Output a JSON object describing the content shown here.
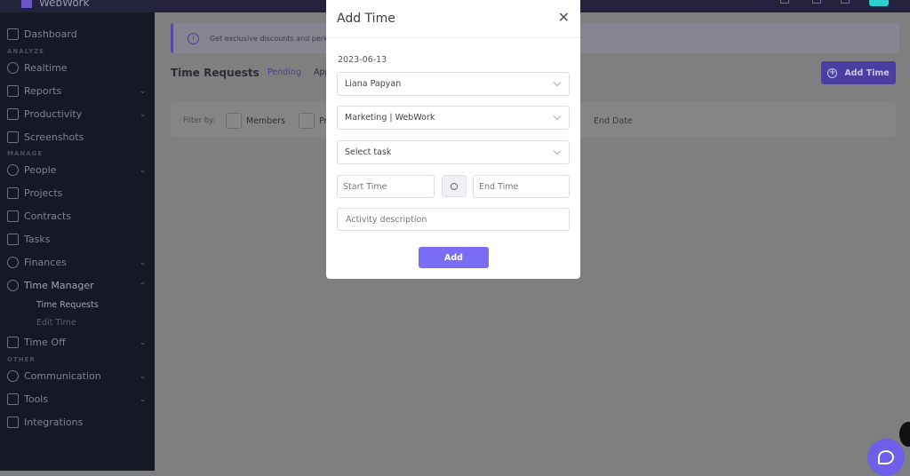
{
  "header": {
    "logo_text": "WebWork"
  },
  "sidebar": {
    "sections": [
      "ANALYZE",
      "MANAGE",
      "OTHER"
    ],
    "items": [
      {
        "label": "Dashboard",
        "icon": "grid-icon"
      },
      {
        "label": "Realtime",
        "icon": "clock-icon"
      },
      {
        "label": "Reports",
        "icon": "report-icon"
      },
      {
        "label": "Productivity",
        "icon": "chart-icon"
      },
      {
        "label": "Screenshots",
        "icon": "image-icon"
      },
      {
        "label": "People",
        "icon": "people-icon"
      },
      {
        "label": "Projects",
        "icon": "briefcase-icon"
      },
      {
        "label": "Contracts",
        "icon": "contract-icon"
      },
      {
        "label": "Tasks",
        "icon": "checkbox-icon"
      },
      {
        "label": "Finances",
        "icon": "dollar-icon"
      },
      {
        "label": "Time Manager",
        "icon": "stopwatch-icon"
      },
      {
        "label": "Time Off",
        "icon": "calendar-icon"
      },
      {
        "label": "Communication",
        "icon": "chat-icon"
      },
      {
        "label": "Tools",
        "icon": "tools-icon"
      },
      {
        "label": "Integrations",
        "icon": "puzzle-icon"
      }
    ],
    "subitems": [
      "Time Requests",
      "Edit Time"
    ]
  },
  "main": {
    "banner": "Get exclusive discounts and perks",
    "title": "Time Requests",
    "tabs": [
      "Pending",
      "App"
    ],
    "add_time": "Add Time",
    "filter_label": "Filter by:",
    "filters": [
      "Members",
      "Pr"
    ],
    "end_date": "End Date"
  },
  "modal": {
    "title": "Add Time",
    "date": "2023-06-13",
    "member": "Liana Papyan",
    "project": "Marketing | WebWork",
    "task_placeholder": "Select task",
    "start_placeholder": "Start Time",
    "end_placeholder": "End Time",
    "description_placeholder": "Activity description",
    "add": "Add"
  },
  "colors": {
    "accent": "#7b6cf6",
    "sidebar": "#151925"
  }
}
